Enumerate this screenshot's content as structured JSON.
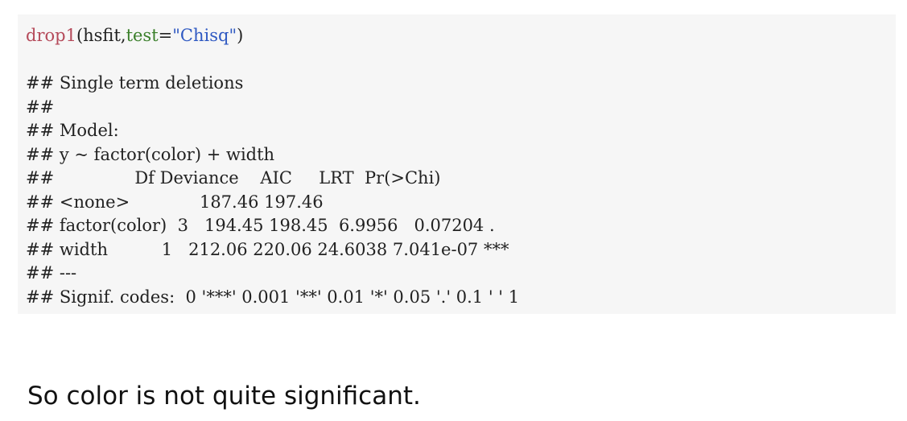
{
  "code": {
    "call": {
      "fn": "drop1",
      "open": "(hsfit,",
      "arg_name": "test",
      "eq": "=",
      "string": "\"Chisq\"",
      "close": ")"
    },
    "output": [
      "## Single term deletions",
      "##",
      "## Model:",
      "## y ~ factor(color) + width",
      "##               Df Deviance    AIC     LRT  Pr(>Chi)",
      "## <none>             187.46 197.46",
      "## factor(color)  3   194.45 198.45  6.9956   0.07204 .",
      "## width          1   212.06 220.06 24.6038 7.041e-07 ***",
      "## ---",
      "## Signif. codes:  0 '***' 0.001 '**' 0.01 '*' 0.05 '.' 0.1 ' ' 1"
    ]
  },
  "prose": "So color is not quite significant."
}
